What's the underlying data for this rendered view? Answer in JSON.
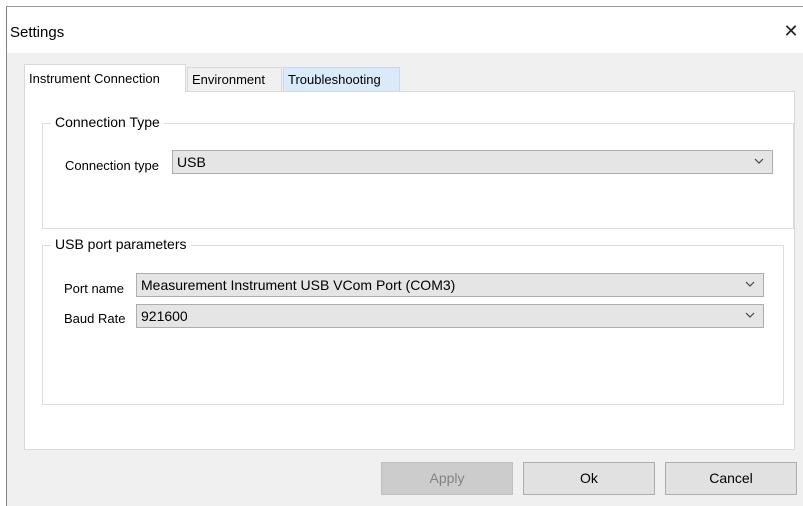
{
  "window": {
    "title": "Settings",
    "close_glyph": "✕"
  },
  "tabs": [
    {
      "label": "Instrument Connection",
      "active": true
    },
    {
      "label": "Environment",
      "active": false
    },
    {
      "label": "Troubleshooting",
      "active": false,
      "hovered": true
    }
  ],
  "connection_group": {
    "legend": "Connection Type",
    "type_label": "Connection type",
    "type_value": "USB"
  },
  "usb_group": {
    "legend": "USB port parameters",
    "port_label": "Port name",
    "port_value": "Measurement Instrument USB VCom Port (COM3)",
    "baud_label": "Baud Rate",
    "baud_value": "921600"
  },
  "buttons": {
    "apply": {
      "label": "Apply",
      "enabled": false
    },
    "ok": {
      "label": "Ok",
      "enabled": true
    },
    "cancel": {
      "label": "Cancel",
      "enabled": true
    }
  },
  "icons": {
    "dropdown": "chevron-down-icon",
    "close": "close-icon"
  },
  "colors": {
    "dialog_bg": "#f0f0f0",
    "combo_bg": "#e5e5e5",
    "tab_hover": "#d9ebf9"
  }
}
